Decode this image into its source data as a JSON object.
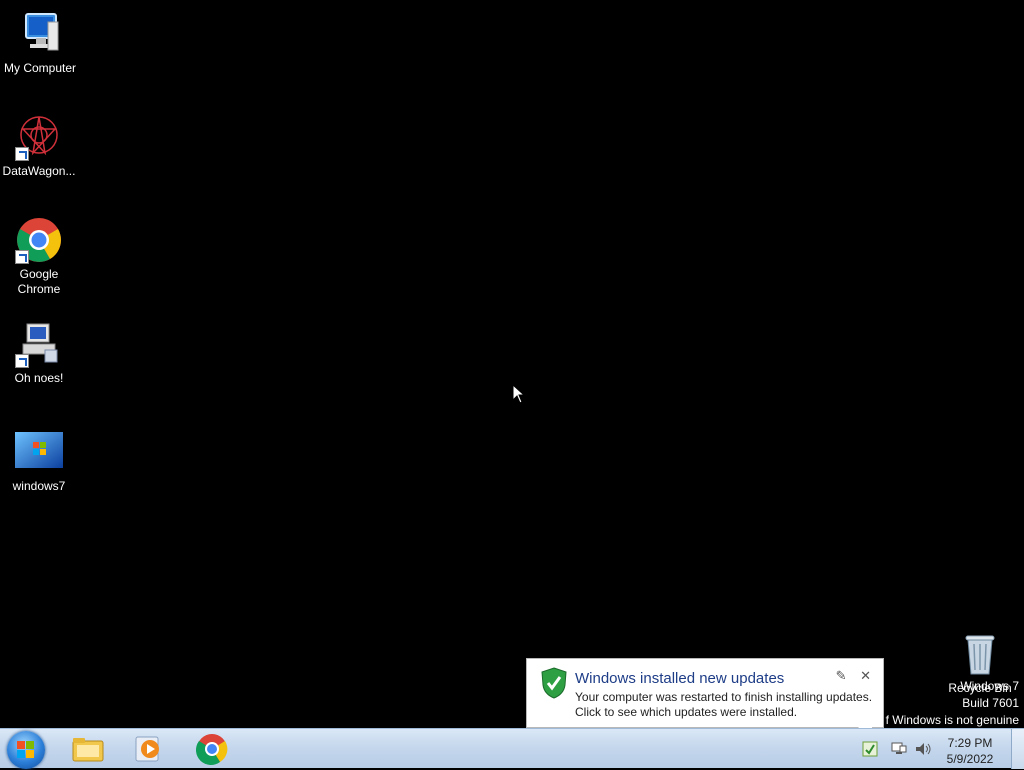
{
  "desktop_icons": [
    {
      "label": "My Computer"
    },
    {
      "label": "DataWagon..."
    },
    {
      "label": "Google\nChrome"
    },
    {
      "label": "Oh noes!"
    },
    {
      "label": "windows7"
    }
  ],
  "recycle_bin": {
    "label": "Recycle Bin"
  },
  "watermark": {
    "line1": "Windows 7",
    "line2": "Build 7601",
    "line3": "f Windows is not genuine"
  },
  "balloon": {
    "title": "Windows installed new updates",
    "line1": "Your computer was restarted to finish installing updates.",
    "line2": "Click to see which updates were installed.",
    "close_glyph": "✕",
    "options_glyph": "✎"
  },
  "taskbar": {
    "pinned": [
      "explorer-icon",
      "media-player-icon",
      "chrome-icon"
    ]
  },
  "clock": {
    "time": "7:29 PM",
    "date": "5/9/2022"
  },
  "colors": {
    "taskbar": "#c3d6ec",
    "balloon_title": "#1e3d87"
  }
}
